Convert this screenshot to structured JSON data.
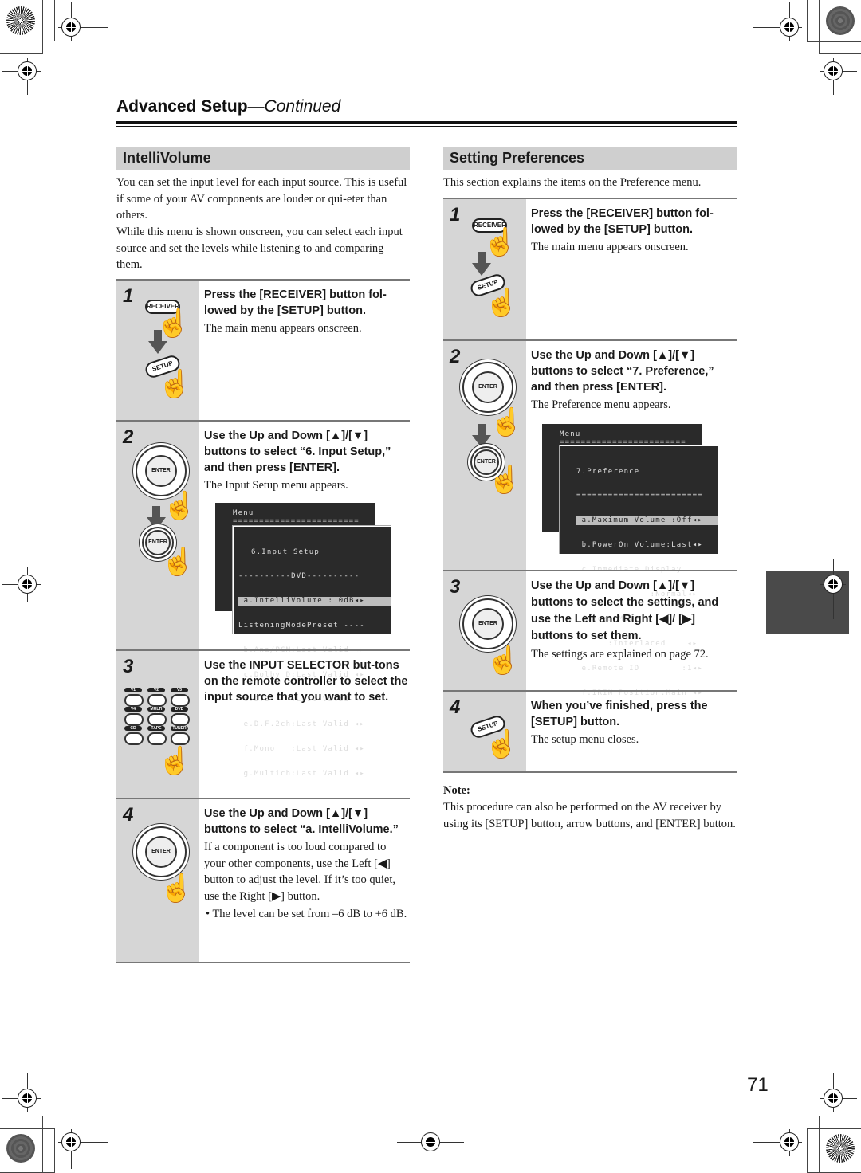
{
  "header": {
    "title": "Advanced Setup",
    "title_suffix": "—Continued"
  },
  "left_section": {
    "heading": "IntelliVolume",
    "intro_1": "You can set the input level for each input source. This is useful if some of your AV components are louder or qui-eter than others.",
    "intro_2": "While this menu is shown onscreen, you can select each input source and set the levels while listening to and comparing them.",
    "steps": [
      {
        "number": "1",
        "heading": "Press the [RECEIVER] button fol-lowed by the [SETUP] button.",
        "description": "The main menu appears onscreen.",
        "icons": [
          "receiver-button",
          "setup-button"
        ]
      },
      {
        "number": "2",
        "heading": "Use the Up and Down [▲]/[▼] buttons to select “6. Input Setup,” and then press [ENTER].",
        "description": "The Input Setup menu appears.",
        "osd_back": [
          "Menu",
          "========================"
        ],
        "osd_front": [
          "6.Input Setup",
          "----------DVD----------",
          " a.IntelliVolume : 0dB◂▸",
          "ListeningModePreset ----",
          " b.Ana/PCM:Last Valid ◂▸",
          " c.Dolby D:Last Valid ◂▸",
          " d.DTS    :Last Valid ◂▸",
          " e.D.F.2ch:Last Valid ◂▸",
          " f.Mono   :Last Valid ◂▸",
          " g.Multich:Last Valid ◂▸"
        ],
        "icons": [
          "enter-dpad",
          "enter-button"
        ]
      },
      {
        "number": "3",
        "heading": "Use the INPUT SELECTOR but-tons on the remote controller to select the input source that you want to set.",
        "selector_buttons": [
          "V1",
          "V2",
          "V3",
          "V4",
          "MULTI CH",
          "DVD",
          "CD",
          "TAPE",
          "TUNER"
        ]
      },
      {
        "number": "4",
        "heading": "Use the Up and Down [▲]/[▼] buttons to select “a. IntelliVolume.”",
        "description": "If a component is too loud compared to your other components, use the Left [◀] button to adjust the level. If it’s too quiet, use the Right [▶] button.",
        "bullet": "The level can be set from –6 dB to +6 dB."
      }
    ]
  },
  "right_section": {
    "heading": "Setting Preferences",
    "intro": "This section explains the items on the Preference menu.",
    "steps": [
      {
        "number": "1",
        "heading": "Press the [RECEIVER] button fol-lowed by the [SETUP] button.",
        "description": "The main menu appears onscreen."
      },
      {
        "number": "2",
        "heading": "Use the Up and Down [▲]/[▼] buttons to select “7. Preference,” and then press [ENTER].",
        "description": "The Preference menu appears.",
        "osd_back": [
          "Menu",
          "========================"
        ],
        "osd_front": [
          "7.Preference",
          "========================",
          " a.Maximum Volume :Off◂▸",
          " b.PowerOn Volume:Last◂▸",
          " c.Immediate Display",
          "              :Normal◂▸",
          " d.Scan Mode",
          "      :Interlaced    ◂▸",
          " e.Remote ID        :1◂▸",
          " f.IRIN Position:Main ◂▸"
        ]
      },
      {
        "number": "3",
        "heading": "Use the Up and Down [▲]/[▼] buttons to select the settings, and use the Left and Right [◀]/ [▶] buttons to set them.",
        "description": "The settings are explained on page 72."
      },
      {
        "number": "4",
        "heading": "When you’ve finished, press the [SETUP] button.",
        "description": "The setup menu closes."
      }
    ],
    "note_label": "Note:",
    "note_text": "This procedure can also be performed on the AV receiver by using its [SETUP] button, arrow buttons, and [ENTER] button."
  },
  "labels": {
    "receiver": "RECEIVER",
    "setup": "SETUP",
    "enter": "ENTER"
  },
  "page_number": "71"
}
